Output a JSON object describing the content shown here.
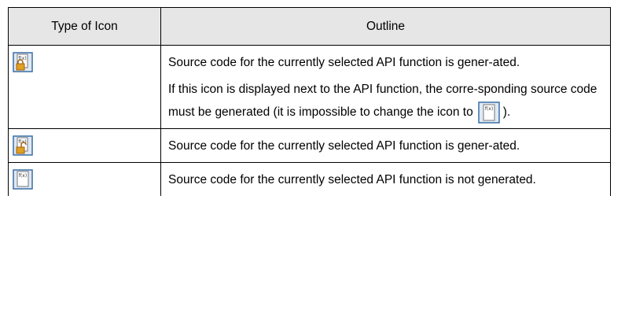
{
  "table": {
    "headers": [
      "Type of Icon",
      "Outline"
    ],
    "rows": [
      {
        "icon": "api-function-locked-icon",
        "paragraphs": [
          "Source code for the currently selected API function is gener-ated.",
          "If this icon is displayed next to the API function, the corre-sponding source code must be generated (it is impossible to change the icon to"
        ],
        "inline_icon": "api-function-not-generated-icon",
        "after_inline": ")."
      },
      {
        "icon": "api-function-unlocked-icon",
        "paragraphs": [
          "Source code for the currently selected API function is gener-ated."
        ]
      },
      {
        "icon": "api-function-not-generated-icon",
        "paragraphs": [
          "Source code for the currently selected API function is not generated."
        ]
      }
    ]
  },
  "colors": {
    "header_bg": "#e6e6e6",
    "icon_frame": "#3a6ea5",
    "lock": "#e0a020"
  }
}
